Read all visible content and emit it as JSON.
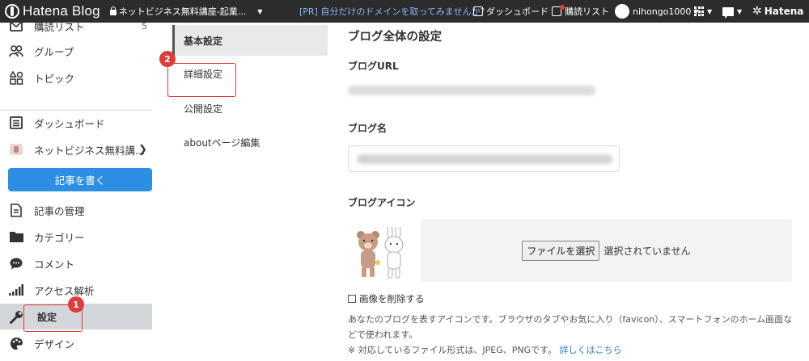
{
  "topbar": {
    "brand": "Hatena Blog",
    "blog_name": "ネットビジネス無料講座-起業...",
    "promo": "[PR] 自分だけのドメインを取ってみませんか？",
    "dashboard": "ダッシュボード",
    "reading_list": "購読リスト",
    "user": "nihongo1000",
    "hatena": "Hatena"
  },
  "sidebar": {
    "items": [
      {
        "label": "購読リスト",
        "count": "5"
      },
      {
        "label": "グループ"
      },
      {
        "label": "トピック"
      },
      {
        "label": "ダッシュボード"
      },
      {
        "label": "ネットビジネス無料講..."
      },
      {
        "label": "記事の管理"
      },
      {
        "label": "カテゴリー"
      },
      {
        "label": "コメント"
      },
      {
        "label": "アクセス解析"
      },
      {
        "label": "設定"
      },
      {
        "label": "デザイン"
      }
    ],
    "write_button": "記事を書く"
  },
  "markers": {
    "one": "1",
    "two": "2"
  },
  "subnav": {
    "items": [
      {
        "label": "基本設定"
      },
      {
        "label": "詳細設定"
      },
      {
        "label": "公開設定"
      },
      {
        "label": "aboutページ編集"
      }
    ]
  },
  "main": {
    "title": "ブログ全体の設定",
    "url_label": "ブログURL",
    "name_label": "ブログ名",
    "icon_label": "ブログアイコン",
    "file_button": "ファイルを選択",
    "file_status": "選択されていません",
    "delete_image": "画像を削除する",
    "help_text": "あなたのブログを表すアイコンです。ブラウザのタブやお気に入り（favicon）、スマートフォンのホーム画面などで使われます。",
    "format_note": "※ 対応しているファイル形式は、JPEG、PNGです。",
    "details_link": "詳しくはこちら"
  },
  "colors": {
    "topbar": "#2c2c2c",
    "write_button": "#2d8fe3",
    "marker": "#e03a3a",
    "link": "#2d78c4"
  }
}
